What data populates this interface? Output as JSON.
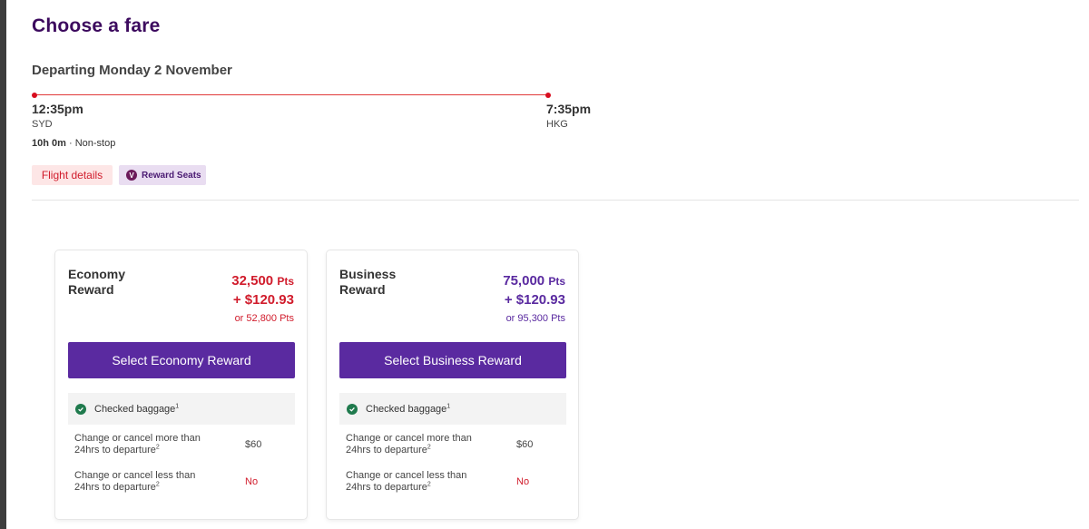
{
  "page": {
    "title": "Choose a fare"
  },
  "flight": {
    "heading": "Departing Monday 2 November",
    "depart_time": "12:35pm",
    "depart_airport": "SYD",
    "arrive_time": "7:35pm",
    "arrive_airport": "HKG",
    "duration": "10h 0m",
    "stops": "Non-stop",
    "separator": "·",
    "details_label": "Flight details",
    "reward_badge_icon": "V",
    "reward_badge_label": "Reward Seats"
  },
  "fares": {
    "economy": {
      "name": "Economy Reward",
      "points": "32,500",
      "points_unit": "Pts",
      "cash": "+ $120.93",
      "alt": "or 52,800 Pts",
      "select_label": "Select Economy Reward",
      "baggage_label": "Checked baggage",
      "baggage_sup": "1",
      "change_more_label": "Change or cancel more than 24hrs to departure",
      "change_more_sup": "2",
      "change_more_value": "$60",
      "change_less_label": "Change or cancel less than 24hrs to departure",
      "change_less_sup": "2",
      "change_less_value": "No"
    },
    "business": {
      "name": "Business Reward",
      "points": "75,000",
      "points_unit": "Pts",
      "cash": "+ $120.93",
      "alt": "or 95,300 Pts",
      "select_label": "Select Business Reward",
      "baggage_label": "Checked baggage",
      "baggage_sup": "1",
      "change_more_label": "Change or cancel more than 24hrs to departure",
      "change_more_sup": "2",
      "change_more_value": "$60",
      "change_less_label": "Change or cancel less than 24hrs to departure",
      "change_less_sup": "2",
      "change_less_value": "No"
    }
  },
  "colors": {
    "brand_purple": "#5a2aa0",
    "title_purple": "#3c0a5e",
    "accent_red": "#d11c2c",
    "check_green": "#1f7a4d"
  },
  "icons": {
    "timeline_start": "timeline-start-dot-icon",
    "timeline_end": "timeline-end-dot-icon",
    "reward_badge": "virgin-logo-icon",
    "baggage_check": "check-circle-icon"
  }
}
